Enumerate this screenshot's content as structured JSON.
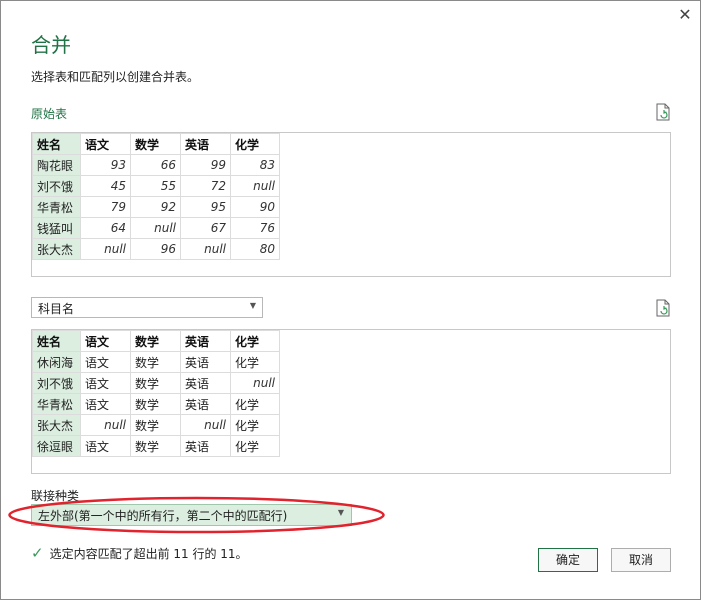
{
  "dialog": {
    "title": "合并",
    "subtitle": "选择表和匹配列以创建合并表。",
    "close_label": "✕"
  },
  "table1": {
    "label": "原始表",
    "headers": [
      "姓名",
      "语文",
      "数学",
      "英语",
      "化学"
    ],
    "rows": [
      [
        "陶花眼",
        "93",
        "66",
        "99",
        "83"
      ],
      [
        "刘不饿",
        "45",
        "55",
        "72",
        "null"
      ],
      [
        "华青松",
        "79",
        "92",
        "95",
        "90"
      ],
      [
        "钱猛叫",
        "64",
        "null",
        "67",
        "76"
      ],
      [
        "张大杰",
        "null",
        "96",
        "null",
        "80"
      ]
    ]
  },
  "table2": {
    "selected": "科目名",
    "headers": [
      "姓名",
      "语文",
      "数学",
      "英语",
      "化学"
    ],
    "rows": [
      [
        "休闲海",
        "语文",
        "数学",
        "英语",
        "化学"
      ],
      [
        "刘不饿",
        "语文",
        "数学",
        "英语",
        "null"
      ],
      [
        "华青松",
        "语文",
        "数学",
        "英语",
        "化学"
      ],
      [
        "张大杰",
        "null",
        "数学",
        "null",
        "化学"
      ],
      [
        "徐逗眼",
        "语文",
        "数学",
        "英语",
        "化学"
      ]
    ]
  },
  "join": {
    "label": "联接种类",
    "selected": "左外部(第一个中的所有行，第二个中的匹配行)"
  },
  "status": {
    "text": "选定内容匹配了超出前 11 行的 11。"
  },
  "buttons": {
    "ok": "确定",
    "cancel": "取消"
  },
  "colors": {
    "accent": "#217346",
    "key_column_bg": "#dbeee0",
    "highlight_ellipse": "#e0232d"
  },
  "icons": [
    "close-icon",
    "refresh-icon",
    "chevron-down-icon",
    "checkmark-icon"
  ]
}
